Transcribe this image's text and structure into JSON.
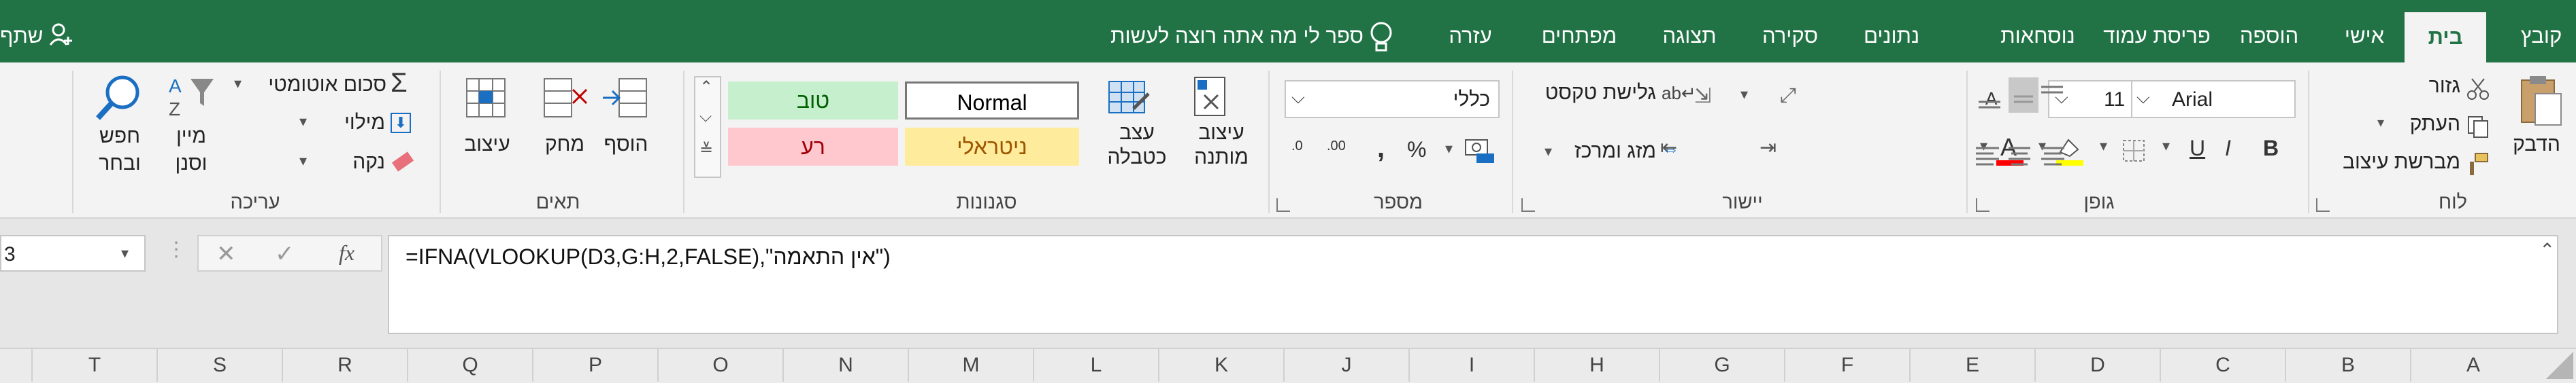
{
  "tabs": [
    {
      "label": "קובץ",
      "active": false
    },
    {
      "label": "בית",
      "active": true
    },
    {
      "label": "אישי",
      "active": false
    },
    {
      "label": "הוספה",
      "active": false
    },
    {
      "label": "פריסת עמוד",
      "active": false
    },
    {
      "label": "נוסחאות",
      "active": false
    },
    {
      "label": "נתונים",
      "active": false
    },
    {
      "label": "סקירה",
      "active": false
    },
    {
      "label": "תצוגה",
      "active": false
    },
    {
      "label": "מפתחים",
      "active": false
    },
    {
      "label": "עזרה",
      "active": false
    }
  ],
  "tell_me": "ספר לי מה אתה רוצה לעשות",
  "share": "שתף",
  "clipboard": {
    "paste": "הדבק",
    "cut": "גזור",
    "copy": "העתק",
    "format_painter": "מברשת עיצוב",
    "label": "לוח"
  },
  "font": {
    "name": "Arial",
    "size": "11",
    "bold": "B",
    "italic": "I",
    "underline": "U",
    "grow": "A",
    "shrink": "A",
    "label": "גופן",
    "font_color": "#ff0000",
    "highlight_color": "#ffff00"
  },
  "alignment": {
    "wrap": "גלישת טקסט",
    "merge": "מזג ומרכז",
    "label": "יישור"
  },
  "number": {
    "format": "כללי",
    "percent": "%",
    "comma": ",",
    "label": "מספר",
    "inc_dec": ".00",
    "dec_dec": ".0"
  },
  "styles": {
    "conditional": "עיצוב מותנה",
    "table": "עצב כטבלה",
    "cells": [
      {
        "name": "Normal"
      },
      {
        "name": "טוב"
      },
      {
        "name": "ניטראלי"
      },
      {
        "name": "רע"
      }
    ],
    "label": "סגנונות"
  },
  "cells_group": {
    "insert": "הוסף",
    "delete": "מחק",
    "format": "עיצוב",
    "label": "תאים"
  },
  "editing": {
    "autosum": "סכום אוטומטי",
    "fill": "מילוי",
    "clear": "נקה",
    "sort_line1": "מיין",
    "sort_line2": "וסנן",
    "find_line1": "חפש",
    "find_line2": "ובחר",
    "label": "עריכה"
  },
  "formula_bar": {
    "name_box": "3",
    "fx": "fx",
    "formula": "=IFNA(VLOOKUP(D3,G:H,2,FALSE),\"אין התאמה\")"
  },
  "columns": [
    "A",
    "B",
    "C",
    "D",
    "E",
    "F",
    "G",
    "H",
    "I",
    "J",
    "K",
    "L",
    "M",
    "N",
    "O",
    "P",
    "Q",
    "R",
    "S",
    "T"
  ],
  "colors": {
    "accent": "#217346",
    "good_bg": "#c6efce",
    "good_fg": "#006100",
    "neutral_bg": "#ffeb9c",
    "neutral_fg": "#9c5700",
    "bad_bg": "#ffc7ce",
    "bad_fg": "#9c0006"
  }
}
